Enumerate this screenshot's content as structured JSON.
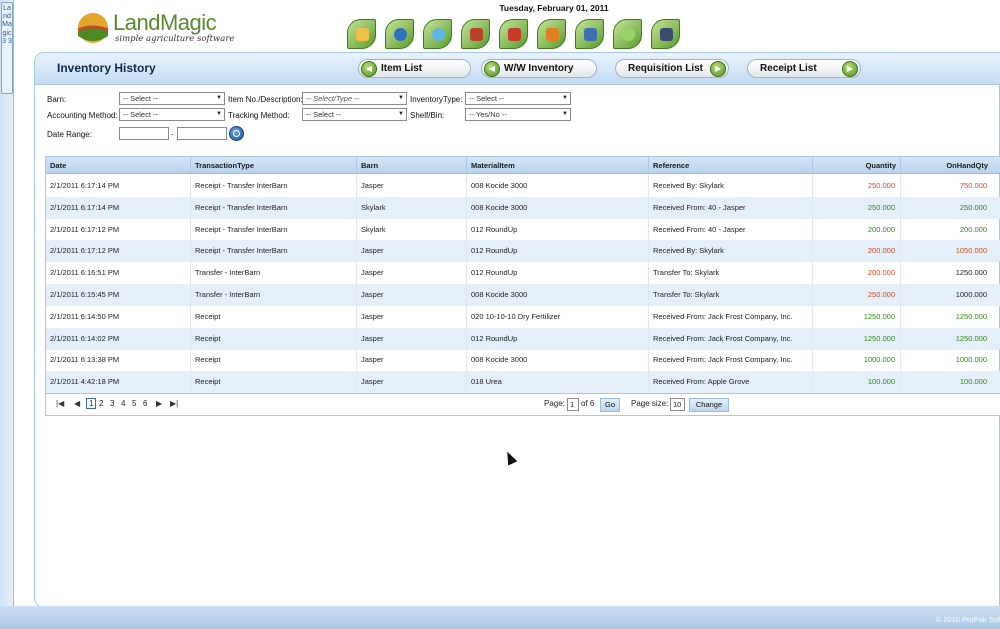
{
  "sidebar": {
    "tab_label": "LandMagic 3 3"
  },
  "header": {
    "date": "Tuesday, February 01, 2011",
    "brand": "LandMagic",
    "tagline": "simple agriculture software",
    "icons": [
      "vegetable-icon",
      "globe-icon",
      "water-drop-icon",
      "barn-icon",
      "farm-icon",
      "fruit-icon",
      "field-icon",
      "leaf-icon",
      "computer-icon"
    ]
  },
  "panel": {
    "title": "Inventory History",
    "buttons": {
      "item_list": "Item List",
      "ww_inventory": "W/W Inventory",
      "requisition_list": "Requisition List",
      "receipt_list": "Receipt List"
    }
  },
  "filters": {
    "barn_label": "Barn:",
    "barn_value": "-- Select --",
    "item_label": "Item No./Description:",
    "item_placeholder": "-- Select/Type --",
    "inventory_type_label": "InventoryType:",
    "inventory_type_value": "-- Select --",
    "accounting_label": "Accounting Method:",
    "accounting_value": "-- Select --",
    "tracking_label": "Tracking Method:",
    "tracking_value": "-- Select --",
    "shelf_label": "Shelf/Bin:",
    "shelf_value": "-- Yes/No --",
    "date_range_label": "Date Range:",
    "date_separator": "-"
  },
  "grid": {
    "columns": [
      "Date",
      "TransactionType",
      "Barn",
      "MaterialItem",
      "Reference",
      "Quantity",
      "OnHandQty"
    ],
    "rows": [
      {
        "date": "2/1/2011 6:17:14 PM",
        "type": "Receipt - Transfer InterBarn",
        "barn": "Jasper",
        "item": "008 Kocide 3000",
        "ref": "Received By: Skylark",
        "qty": "250.000",
        "onhand": "750.000",
        "qty_color": "red",
        "onhand_color": "red"
      },
      {
        "date": "2/1/2011 6:17:14 PM",
        "type": "Receipt - Transfer InterBarn",
        "barn": "Skylark",
        "item": "008 Kocide 3000",
        "ref": "Received From: 40 - Jasper",
        "qty": "250.000",
        "onhand": "250.000",
        "qty_color": "green",
        "onhand_color": "green"
      },
      {
        "date": "2/1/2011 6:17:12 PM",
        "type": "Receipt - Transfer InterBarn",
        "barn": "Skylark",
        "item": "012 RoundUp",
        "ref": "Received From: 40 - Jasper",
        "qty": "200.000",
        "onhand": "200.000",
        "qty_color": "green",
        "onhand_color": "green"
      },
      {
        "date": "2/1/2011 6:17:12 PM",
        "type": "Receipt - Transfer InterBarn",
        "barn": "Jasper",
        "item": "012 RoundUp",
        "ref": "Received By: Skylark",
        "qty": "200.000",
        "onhand": "1050.000",
        "qty_color": "red",
        "onhand_color": "red"
      },
      {
        "date": "2/1/2011 6:16:51 PM",
        "type": "Transfer - InterBarn",
        "barn": "Jasper",
        "item": "012 RoundUp",
        "ref": "Transfer To: Skylark",
        "qty": "200.000",
        "onhand": "1250.000",
        "qty_color": "red",
        "onhand_color": "black"
      },
      {
        "date": "2/1/2011 6:15:45 PM",
        "type": "Transfer - InterBarn",
        "barn": "Jasper",
        "item": "008 Kocide 3000",
        "ref": "Transfer To: Skylark",
        "qty": "250.000",
        "onhand": "1000.000",
        "qty_color": "red",
        "onhand_color": "black"
      },
      {
        "date": "2/1/2011 6:14:50 PM",
        "type": "Receipt",
        "barn": "Jasper",
        "item": "020 10-10-10 Dry Fertilizer",
        "ref": "Received From: Jack Frost Company, Inc.",
        "qty": "1250.000",
        "onhand": "1250.000",
        "qty_color": "green",
        "onhand_color": "green"
      },
      {
        "date": "2/1/2011 6:14:02 PM",
        "type": "Receipt",
        "barn": "Jasper",
        "item": "012 RoundUp",
        "ref": "Received From: Jack Frost Company, Inc.",
        "qty": "1250.000",
        "onhand": "1250.000",
        "qty_color": "green",
        "onhand_color": "green"
      },
      {
        "date": "2/1/2011 6:13:38 PM",
        "type": "Receipt",
        "barn": "Jasper",
        "item": "008 Kocide 3000",
        "ref": "Received From: Jack Frost Company, Inc.",
        "qty": "1000.000",
        "onhand": "1000.000",
        "qty_color": "green",
        "onhand_color": "green"
      },
      {
        "date": "2/1/2011 4:42:18 PM",
        "type": "Receipt",
        "barn": "Jasper",
        "item": "018 Urea",
        "ref": "Received From: Apple Grove",
        "qty": "100.000",
        "onhand": "100.000",
        "qty_color": "green",
        "onhand_color": "green"
      }
    ]
  },
  "pager": {
    "pages": [
      "1",
      "2",
      "3",
      "4",
      "5",
      "6"
    ],
    "current_page": "1",
    "page_label": "Page:",
    "page_value": "1",
    "of_label": "of 6",
    "go_label": "Go",
    "page_size_label": "Page size:",
    "page_size_value": "10",
    "change_label": "Change"
  },
  "footer": {
    "copyright": "© 2010 ProPak Sof"
  },
  "colors": {
    "red": "#d94b14",
    "green": "#2e8b0e",
    "black": "#222222",
    "accent": "#a9c6e6"
  }
}
